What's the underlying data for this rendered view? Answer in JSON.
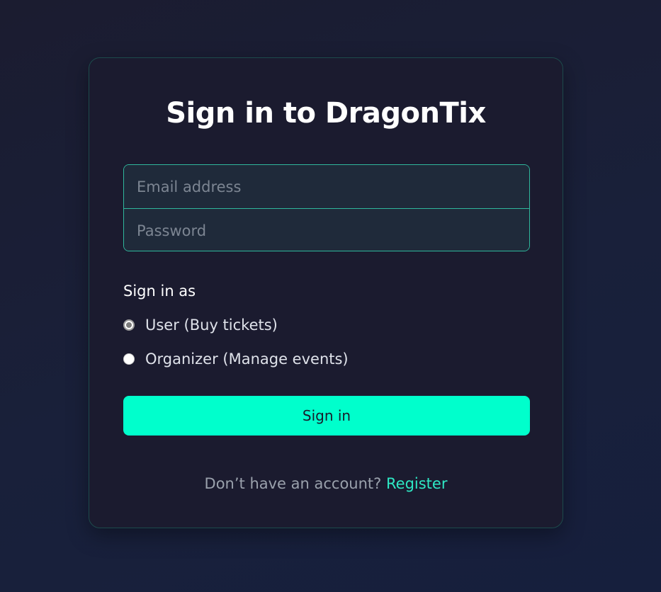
{
  "title": "Sign in to DragonTix",
  "form": {
    "email_placeholder": "Email address",
    "email_value": "",
    "password_placeholder": "Password",
    "password_value": ""
  },
  "role": {
    "label": "Sign in as",
    "options": [
      {
        "label": "User (Buy tickets)",
        "selected": true
      },
      {
        "label": "Organizer (Manage events)",
        "selected": false
      }
    ]
  },
  "submit_label": "Sign in",
  "footer": {
    "prompt": "Don’t have an account?",
    "link_label": "Register"
  },
  "colors": {
    "accent": "#00ffcc",
    "link": "#2ee8c4",
    "card_bg": "#1b1b2f",
    "page_bg": "#1a1f36"
  }
}
